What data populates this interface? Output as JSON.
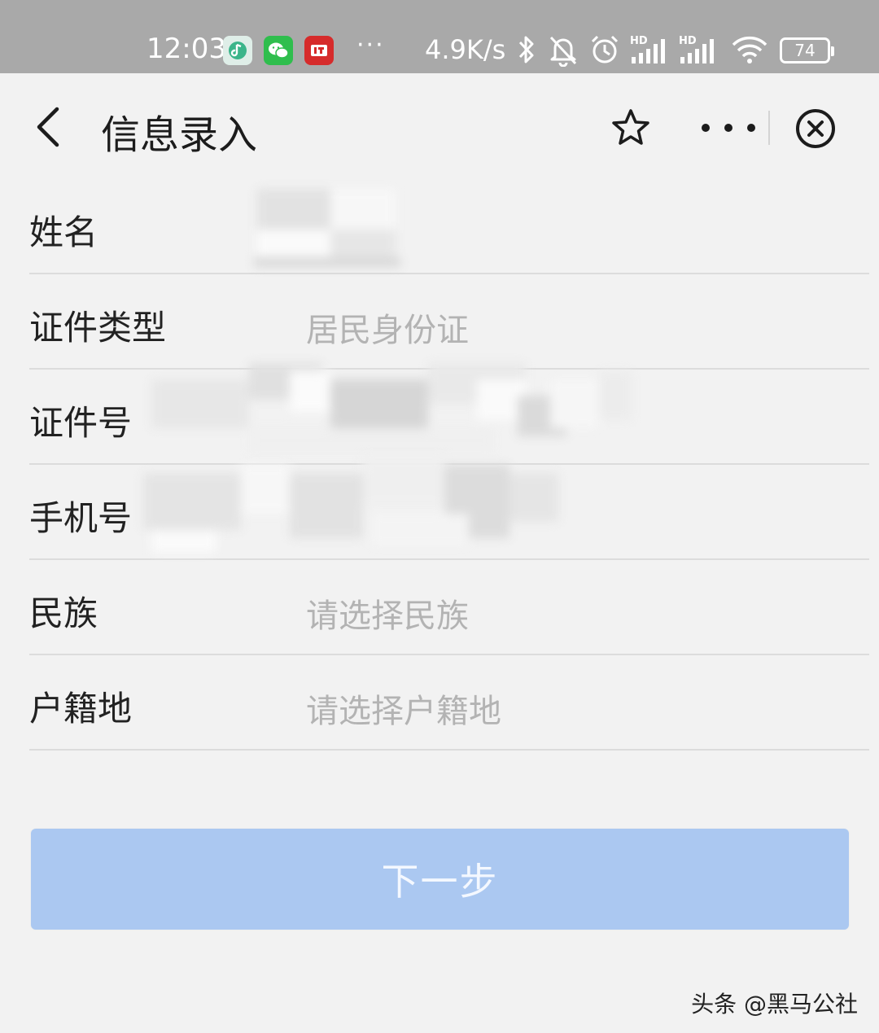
{
  "status_bar": {
    "time": "12:03",
    "more_dots": "···",
    "net_speed": "4.9K/s",
    "battery": "74",
    "icons": [
      "music-app-icon",
      "wechat-icon",
      "news-app-icon",
      "bluetooth-icon",
      "bell-off-icon",
      "alarm-icon",
      "hd-signal-icon",
      "hd-signal-icon",
      "wifi-icon",
      "battery-icon"
    ],
    "signal_label": "HD"
  },
  "nav": {
    "title": "信息录入",
    "icons": [
      "back-arrow-icon",
      "star-icon",
      "more-dots-icon",
      "close-circle-icon"
    ]
  },
  "form": {
    "rows": [
      {
        "label": "姓名",
        "value": ""
      },
      {
        "label": "证件类型",
        "value": "居民身份证"
      },
      {
        "label": "证件号",
        "value": ""
      },
      {
        "label": "手机号",
        "value": ""
      },
      {
        "label": "民族",
        "value": "请选择民族"
      },
      {
        "label": "户籍地",
        "value": "请选择户籍地"
      }
    ]
  },
  "next_button": {
    "label": "下一步",
    "color": "#abc8f1"
  },
  "watermark": "头条 @黑马公社",
  "colors": {
    "status_bar": "#a9a9a9",
    "background": "#f2f2f2",
    "placeholder": "#b3b3b3"
  }
}
